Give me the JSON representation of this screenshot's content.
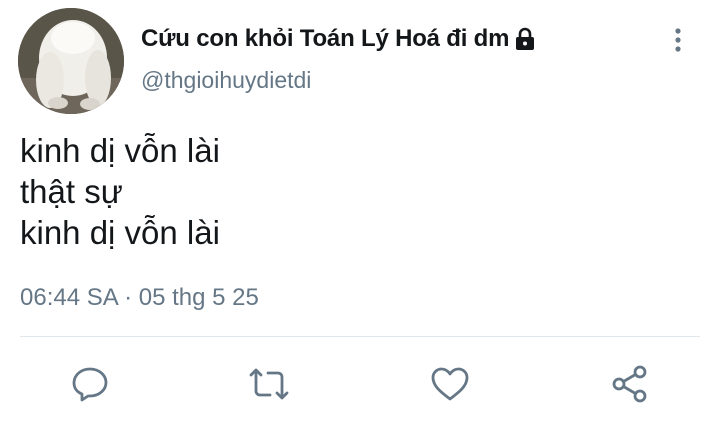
{
  "tweet": {
    "display_name": "Cứu con khỏi Toán Lý Hoá đi dm",
    "handle": "@thgioihuydietdi",
    "protected_icon": "lock-icon",
    "lines": [
      "kinh dị vỗn lài",
      "thật sự",
      "kinh dị vỗn lài"
    ],
    "timestamp": "06:44 SA · 05 thg 5 25"
  },
  "actions": {
    "reply_icon": "comment-icon",
    "retweet_icon": "retweet-icon",
    "like_icon": "heart-icon",
    "share_icon": "share-icon",
    "more_icon": "more-vertical-icon"
  },
  "colors": {
    "text": "#14171a",
    "secondary_text": "#657786",
    "icon": "#657786",
    "divider": "#e1e8ed"
  }
}
